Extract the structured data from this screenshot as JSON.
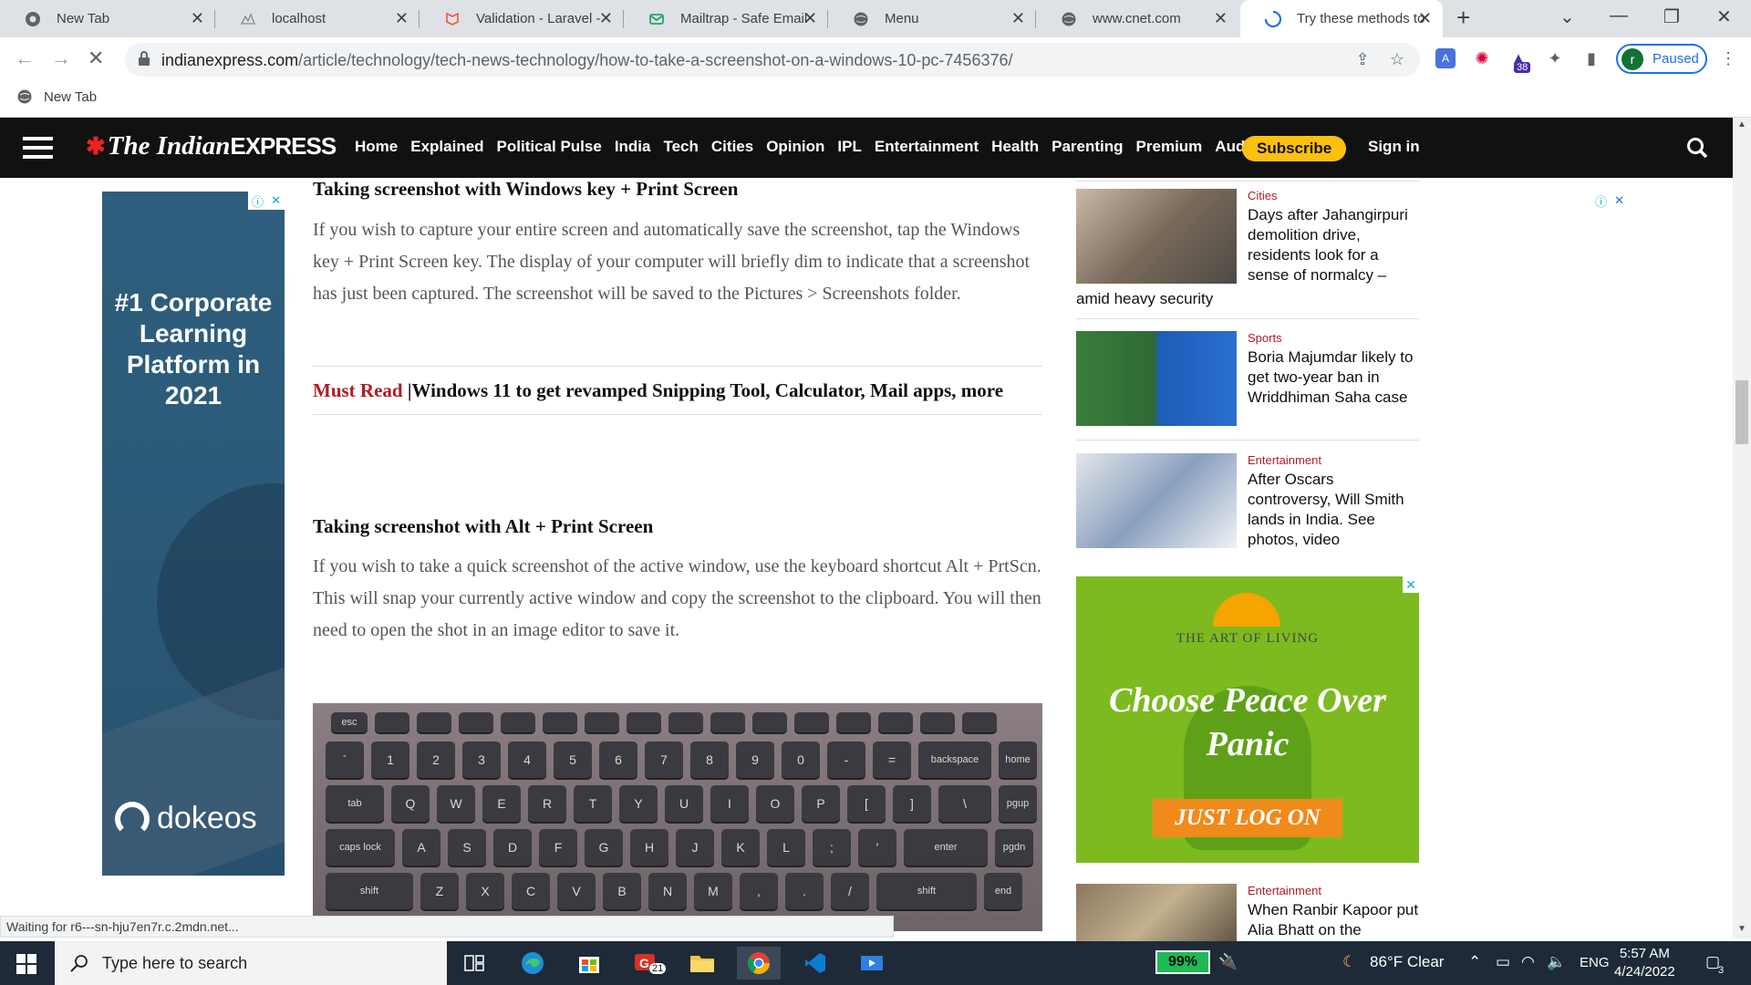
{
  "browser": {
    "tabs": [
      {
        "title": "New Tab",
        "icon": "chrome-icon"
      },
      {
        "title": "localhost",
        "icon": "page-icon"
      },
      {
        "title": "Validation - Laravel - ",
        "icon": "laravel-icon"
      },
      {
        "title": "Mailtrap - Safe Email ",
        "icon": "mailtrap-icon"
      },
      {
        "title": "Menu",
        "icon": "globe-icon"
      },
      {
        "title": "www.cnet.com",
        "icon": "globe-icon"
      },
      {
        "title": "Try these methods to",
        "icon": "loading-icon",
        "active": true
      }
    ],
    "url_domain": "indianexpress.com",
    "url_path": "/article/technology/tech-news-technology/how-to-take-a-screenshot-on-a-windows-10-pc-7456376/",
    "profile_initial": "r",
    "profile_status": "Paused",
    "extension_badge": "38",
    "bookmark": "New Tab"
  },
  "site": {
    "logo_main": "The Indian",
    "logo_express": "EXPRESS",
    "nav": [
      "Home",
      "Explained",
      "Political Pulse",
      "India",
      "Tech",
      "Cities",
      "Opinion",
      "IPL",
      "Entertainment",
      "Health",
      "Parenting",
      "Premium",
      "Audio"
    ],
    "subscribe": "Subscribe",
    "sign_in": "Sign in"
  },
  "left_ad": {
    "headline": "#1 Corporate Learning Platform in 2021",
    "brand": "dokeos"
  },
  "article": {
    "h_winkey": "Taking screenshot with Windows key + Print Screen",
    "p_winkey": "If you wish to capture your entire screen and automatically save the screenshot, tap the Windows key + Print Screen key. The display of your computer will briefly dim to indicate that a screenshot has just been captured. The screenshot will be saved to the Pictures > Screenshots folder.",
    "must_read_label": "Must Read",
    "must_read_sep": " |",
    "must_read_title": "Windows 11 to get revamped Snipping Tool, Calculator, Mail apps, more",
    "h_alt": "Taking screenshot with Alt + Print Screen",
    "p_alt": "If you wish to take a quick screenshot of the active window, use the keyboard shortcut Alt + PrtScn. This will snap your currently active window and copy the screenshot to the clipboard. You will then need to open the shot in an image editor to save it.",
    "keyboard_rows": [
      [
        "esc",
        "",
        "",
        "",
        "",
        "",
        "",
        "",
        "",
        "",
        "",
        "",
        "",
        "",
        "",
        ""
      ],
      [
        "`",
        "1",
        "2",
        "3",
        "4",
        "5",
        "6",
        "7",
        "8",
        "9",
        "0",
        "-",
        "=",
        "backspace",
        "home"
      ],
      [
        "tab",
        "Q",
        "W",
        "E",
        "R",
        "T",
        "Y",
        "U",
        "I",
        "O",
        "P",
        "[",
        "]",
        "\\",
        "pgup"
      ],
      [
        "caps lock",
        "A",
        "S",
        "D",
        "F",
        "G",
        "H",
        "J",
        "K",
        "L",
        ";",
        "'",
        "enter",
        "pgdn"
      ],
      [
        "shift",
        "Z",
        "X",
        "C",
        "V",
        "B",
        "N",
        "M",
        ",",
        ".",
        "/",
        "shift",
        "end"
      ]
    ]
  },
  "rail": {
    "stories": [
      {
        "category": "Cities",
        "headline": "Days after Jahangirpuri demolition drive, residents look for a sense of normalcy –",
        "headline_cont": "amid heavy security"
      },
      {
        "category": "Sports",
        "headline": "Boria Majumdar likely to get two-year ban in Wriddhiman Saha case"
      },
      {
        "category": "Entertainment",
        "headline": "After Oscars controversy, Will Smith lands in India. See photos, video"
      },
      {
        "category": "Entertainment",
        "headline": "When Ranbir Kapoor put Alia Bhatt on the"
      }
    ],
    "ad": {
      "org": "THE ART OF LIVING",
      "headline": "Choose Peace Over Panic",
      "cta": "JUST LOG ON"
    }
  },
  "status_text": "Waiting for r6---sn-hju7en7r.c.2mdn.net...",
  "taskbar": {
    "search_placeholder": "Type here to search",
    "mail_badge": "21",
    "battery": "99%",
    "weather": "86°F  Clear",
    "lang": "ENG",
    "time": "5:57 AM",
    "date": "4/24/2022",
    "notif_count": "3"
  }
}
